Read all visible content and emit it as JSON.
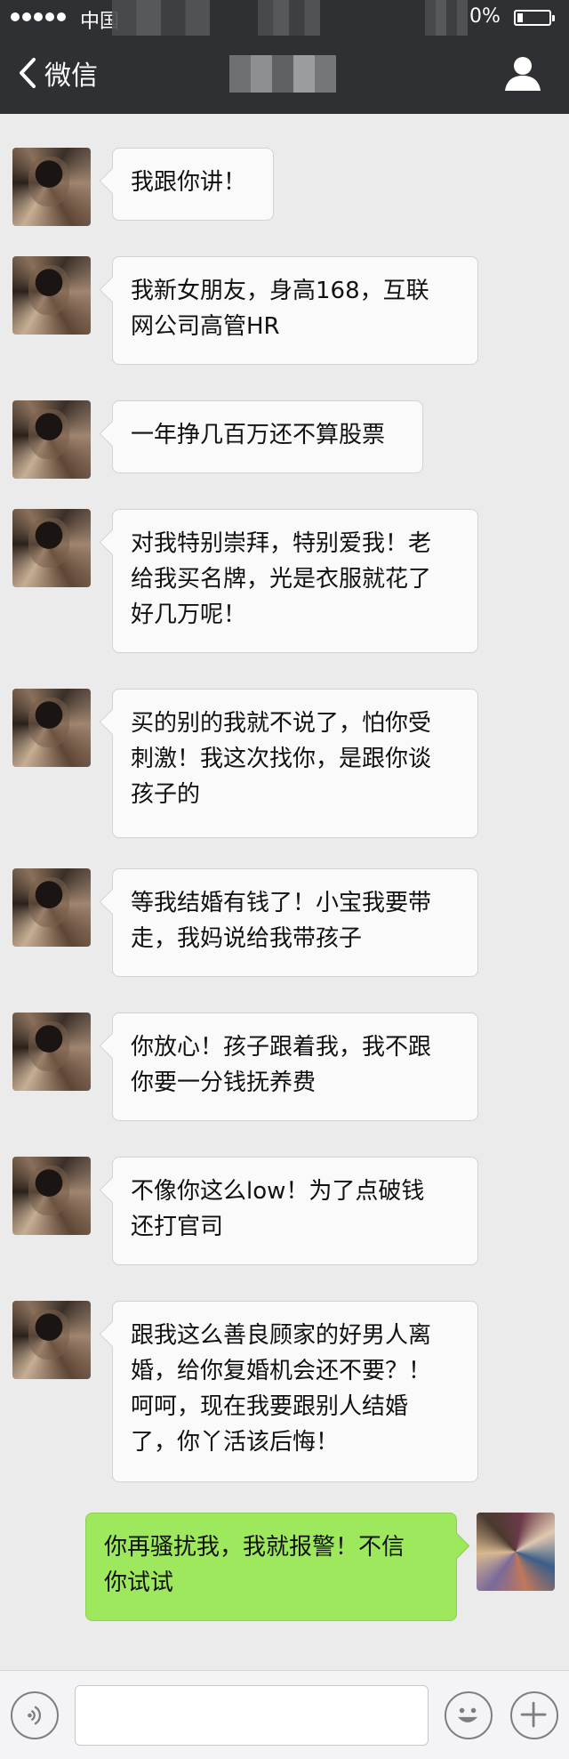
{
  "status_bar": {
    "carrier": "中国",
    "battery_pct": "0%"
  },
  "nav": {
    "back_label": "微信"
  },
  "messages": [
    {
      "side": "left",
      "text": "我跟你讲！"
    },
    {
      "side": "left",
      "text": "我新女朋友，身高168，互联\n网公司高管HR"
    },
    {
      "side": "left",
      "text": "一年挣几百万还不算股票"
    },
    {
      "side": "left",
      "text": "对我特别崇拜，特别爱我！老\n给我买名牌，光是衣服就花了\n好几万呢！"
    },
    {
      "side": "left",
      "text": "买的别的我就不说了，怕你受\n刺激！我这次找你，是跟你谈\n孩子的"
    },
    {
      "side": "left",
      "text": "等我结婚有钱了！小宝我要带\n走，我妈说给我带孩子"
    },
    {
      "side": "left",
      "text": "你放心！孩子跟着我，我不跟\n你要一分钱抚养费"
    },
    {
      "side": "left",
      "text": "不像你这么low！为了点破钱\n还打官司"
    },
    {
      "side": "left",
      "text": "跟我这么善良顾家的好男人离\n婚，给你复婚机会还不要？！\n呵呵，现在我要跟别人结婚\n了，你丫活该后悔！"
    },
    {
      "side": "right",
      "text": "你再骚扰我，我就报警！不信\n你试试"
    }
  ],
  "input_bar": {
    "icons": [
      "voice-icon",
      "emoji-icon",
      "plus-icon"
    ]
  },
  "colors": {
    "nav_bg": "#2e3033",
    "chat_bg": "#ebebeb",
    "my_bubble": "#9de85d",
    "their_bubble": "#fafafa"
  }
}
